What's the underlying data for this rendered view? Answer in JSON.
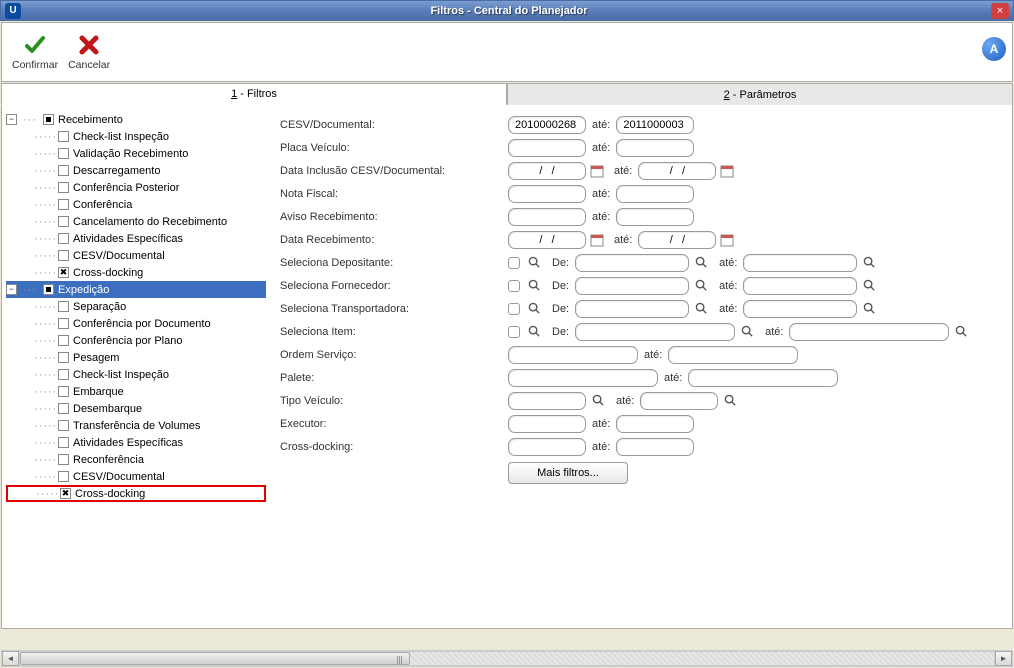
{
  "window": {
    "title": "Filtros - Central do Planejador"
  },
  "toolbar": {
    "confirm": "Confirmar",
    "cancel": "Cancelar"
  },
  "tabs": {
    "filters_num": "1",
    "filters_lbl": " - Filtros",
    "params_num": "2",
    "params_lbl": " - Parâmetros"
  },
  "tree": {
    "recebimento": {
      "label": "Recebimento",
      "children": [
        "Check-list Inspeção",
        "Validação Recebimento",
        "Descarregamento",
        "Conferência Posterior",
        "Conferência",
        "Cancelamento do Recebimento",
        "Atividades Específicas",
        "CESV/Documental",
        "Cross-docking"
      ]
    },
    "expedicao": {
      "label": "Expedição",
      "children": [
        "Separação",
        "Conferência por Documento",
        "Conferência por Plano",
        "Pesagem",
        "Check-list Inspeção",
        "Embarque",
        "Desembarque",
        "Transferência de Volumes",
        "Atividades Específicas",
        "Reconferência",
        "CESV/Documental",
        "Cross-docking"
      ]
    }
  },
  "form": {
    "cesv_lbl": "CESV/Documental:",
    "cesv_from": "2010000268",
    "cesv_to": "2011000003",
    "placa_lbl": "Placa Veículo:",
    "data_incl_lbl": "Data Inclusão CESV/Documental:",
    "date_mask": "/   /",
    "nf_lbl": "Nota Fiscal:",
    "aviso_lbl": "Aviso Recebimento:",
    "data_rec_lbl": "Data Recebimento:",
    "sel_dep_lbl": "Seleciona Depositante:",
    "sel_for_lbl": "Seleciona Fornecedor:",
    "sel_tra_lbl": "Seleciona Transportadora:",
    "sel_item_lbl": "Seleciona Item:",
    "ordem_lbl": "Ordem Serviço:",
    "palete_lbl": "Palete:",
    "tipo_lbl": "Tipo Veículo:",
    "exec_lbl": "Executor:",
    "cross_lbl": "Cross-docking:",
    "ate": "até:",
    "de": "De:",
    "more": "Mais filtros..."
  }
}
